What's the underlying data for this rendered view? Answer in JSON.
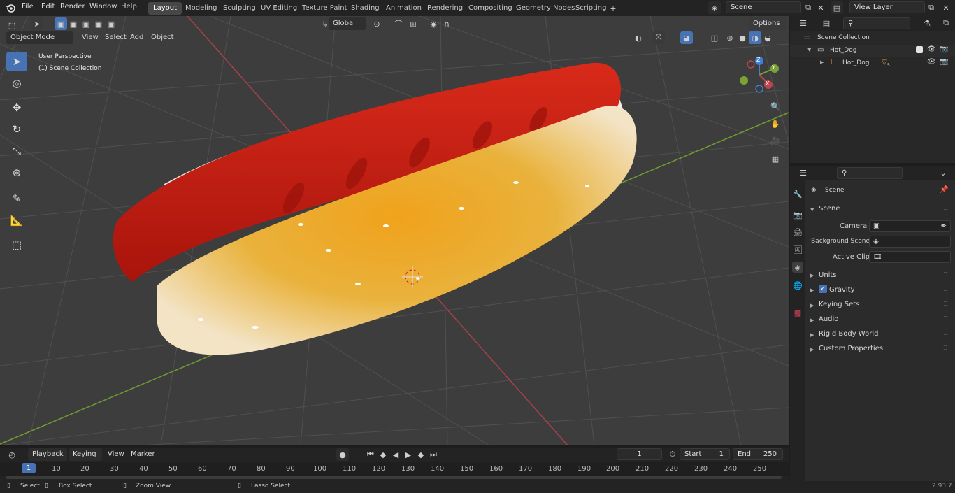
{
  "topbar": {
    "menus": [
      "File",
      "Edit",
      "Render",
      "Window",
      "Help"
    ],
    "workspaces": [
      "Layout",
      "Modeling",
      "Sculpting",
      "UV Editing",
      "Texture Paint",
      "Shading",
      "Animation",
      "Rendering",
      "Compositing",
      "Geometry Nodes",
      "Scripting"
    ],
    "active_workspace": "Layout",
    "scene_name": "Scene",
    "view_layer": "View Layer"
  },
  "viewport": {
    "mode": "Object Mode",
    "header_menus": [
      "View",
      "Select",
      "Add",
      "Object"
    ],
    "orientation": "Global",
    "options_label": "Options",
    "overlay_title": "User Perspective",
    "overlay_subtitle": "(1) Scene Collection",
    "gizmo_axes": {
      "x": "X",
      "y": "Y",
      "z": "Z"
    }
  },
  "outliner": {
    "root": "Scene Collection",
    "collection": "Hot_Dog",
    "object": "Hot_Dog",
    "modifier_count": "5"
  },
  "properties": {
    "header": "Scene",
    "panel": "Scene",
    "camera_label": "Camera",
    "background_scene_label": "Background Scene",
    "active_clip_label": "Active Clip",
    "sections": [
      "Units",
      "Gravity",
      "Keying Sets",
      "Audio",
      "Rigid Body World",
      "Custom Properties"
    ],
    "gravity_checked": true
  },
  "timeline": {
    "menus": [
      "Playback",
      "Keying",
      "View",
      "Marker"
    ],
    "current_frame": "1",
    "start_label": "Start",
    "start_value": "1",
    "end_label": "End",
    "end_value": "250",
    "ruler": [
      "10",
      "20",
      "30",
      "40",
      "50",
      "60",
      "70",
      "80",
      "90",
      "100",
      "110",
      "120",
      "130",
      "140",
      "150",
      "160",
      "170",
      "180",
      "190",
      "200",
      "210",
      "220",
      "230",
      "240",
      "250"
    ],
    "ruler_current": "1"
  },
  "statusbar": {
    "select": "Select",
    "box_select": "Box Select",
    "zoom_view": "Zoom View",
    "lasso_select": "Lasso Select",
    "version": "2.93.7"
  },
  "colors": {
    "accent": "#4772b3",
    "x_axis": "#c0434f",
    "y_axis": "#7aa235",
    "z_axis": "#3f7fd6"
  }
}
